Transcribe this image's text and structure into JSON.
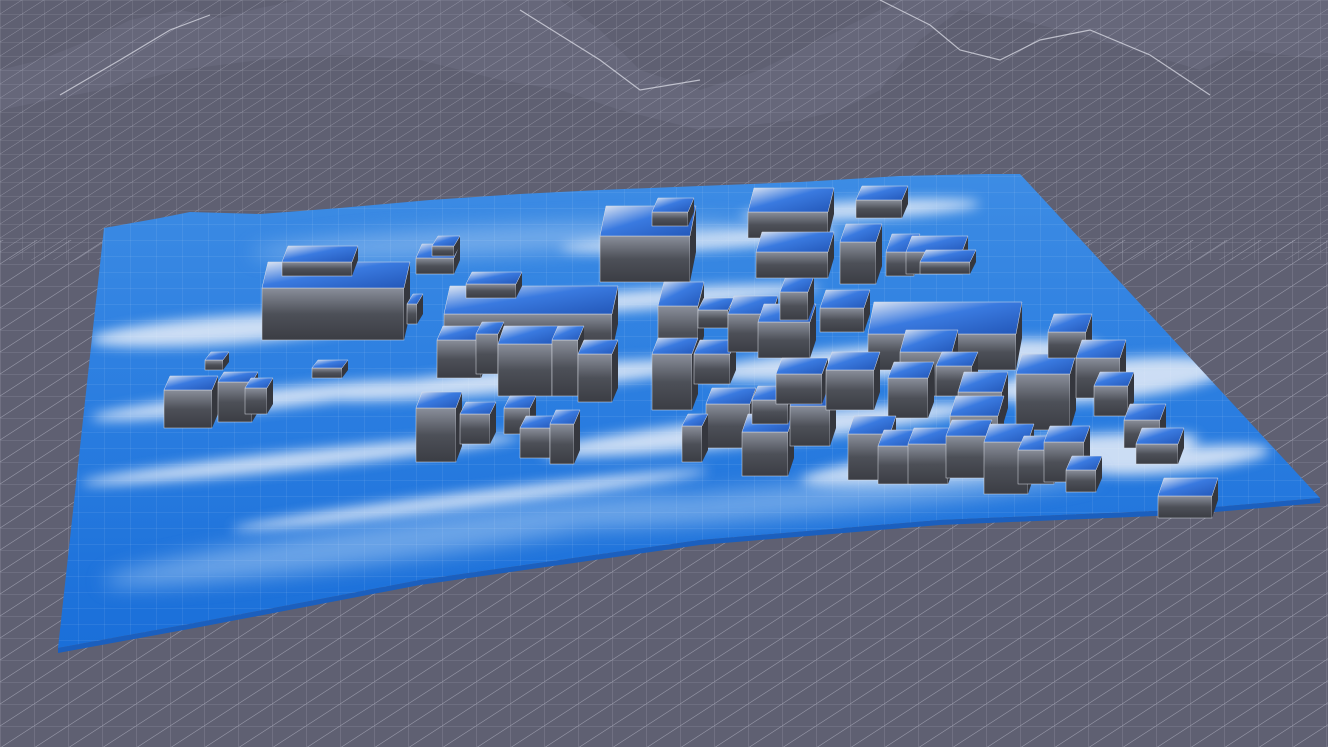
{
  "scene": {
    "background_color": "#5f6072",
    "wireframe_color": "#c9cad6",
    "flow_colors": {
      "high": "#1d6fd8",
      "mid": "#4a94e6",
      "low": "#e8eef6"
    },
    "building_color": "#4b4d55",
    "building_highlight_color": "#2f6fe0",
    "building_edge_color": "#d9dde6"
  }
}
